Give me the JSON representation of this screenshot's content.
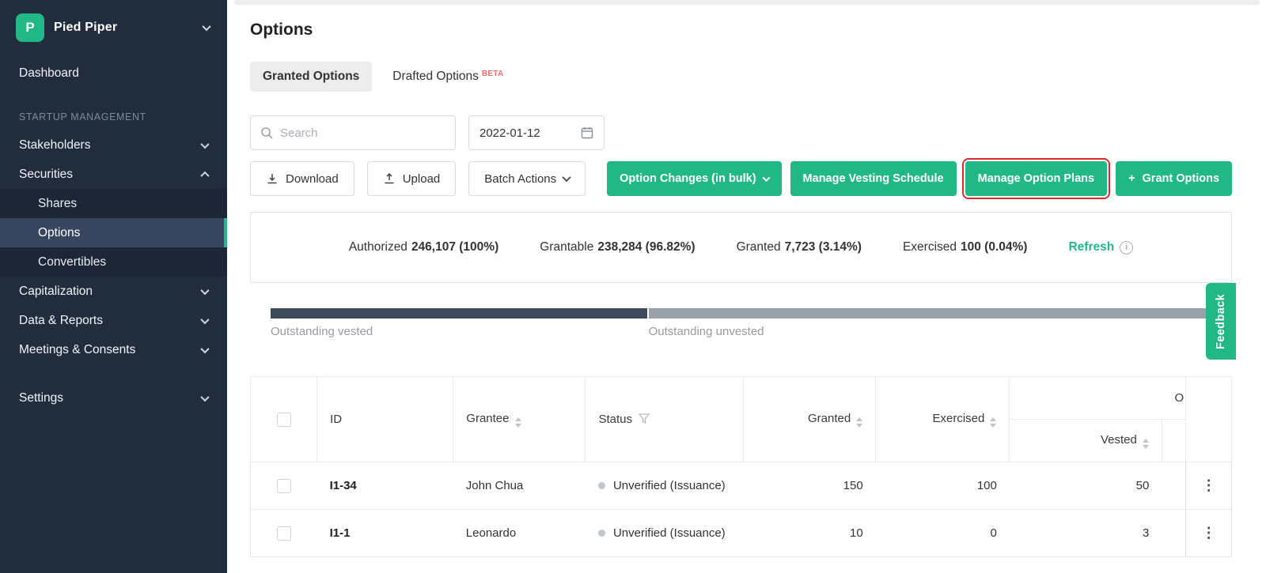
{
  "colors": {
    "accent": "#21b886",
    "annotation_red": "#e02a2a",
    "sidebar_bg": "#212d3d"
  },
  "sidebar": {
    "company_initial": "P",
    "company_name": "Pied Piper",
    "dashboard_label": "Dashboard",
    "section_label": "STARTUP MANAGEMENT",
    "stakeholders_label": "Stakeholders",
    "securities_label": "Securities",
    "shares_label": "Shares",
    "options_label": "Options",
    "convertibles_label": "Convertibles",
    "capitalization_label": "Capitalization",
    "data_reports_label": "Data & Reports",
    "meetings_label": "Meetings & Consents",
    "settings_label": "Settings"
  },
  "page": {
    "title": "Options"
  },
  "tabs": {
    "granted": "Granted Options",
    "drafted": "Drafted Options",
    "beta_badge": "BETA"
  },
  "filters": {
    "search_placeholder": "Search",
    "date_value": "2022-01-12"
  },
  "toolbar": {
    "download": "Download",
    "upload": "Upload",
    "batch_actions": "Batch Actions",
    "option_changes": "Option Changes (in bulk)",
    "manage_vesting": "Manage Vesting Schedule",
    "manage_plans": "Manage Option Plans",
    "plus": "+",
    "grant_options": "Grant Options"
  },
  "summary": {
    "stats": [
      {
        "label": "Authorized",
        "value": "246,107 (100%)"
      },
      {
        "label": "Grantable",
        "value": "238,284 (96.82%)"
      },
      {
        "label": "Granted",
        "value": "7,723 (3.14%)"
      },
      {
        "label": "Exercised",
        "value": "100 (0.04%)"
      }
    ],
    "refresh_label": "Refresh"
  },
  "progress": {
    "vested_label": "Outstanding vested",
    "unvested_label": "Outstanding unvested",
    "vested_percent": 40
  },
  "table": {
    "headers": {
      "id": "ID",
      "grantee": "Grantee",
      "status": "Status",
      "granted": "Granted",
      "exercised": "Exercised",
      "group_truncated": "O",
      "vested": "Vested"
    },
    "rows": [
      {
        "id": "I1-34",
        "grantee": "John Chua",
        "status": "Unverified (Issuance)",
        "granted": "150",
        "exercised": "100",
        "vested": "50"
      },
      {
        "id": "I1-1",
        "grantee": "Leonardo",
        "status": "Unverified (Issuance)",
        "granted": "10",
        "exercised": "0",
        "vested": "3"
      }
    ]
  },
  "feedback_label": "Feedback"
}
